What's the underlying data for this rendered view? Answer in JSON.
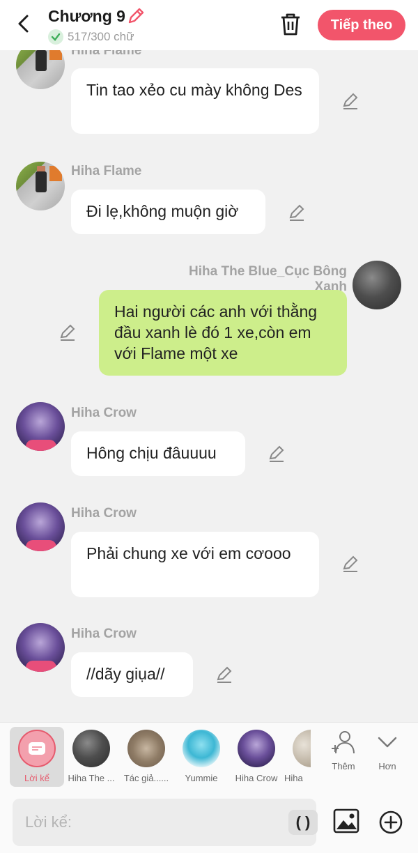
{
  "header": {
    "title": "Chương 9",
    "char_count": "517/300 chữ",
    "next_label": "Tiếp theo",
    "accent": "#f2556b"
  },
  "messages": [
    {
      "sender": "Hiha Flame",
      "text": "Tin tao xẻo cu mày không Des",
      "side": "left",
      "avatar": "flame"
    },
    {
      "sender": "Hiha Flame",
      "text": "Đi lẹ,không muộn giờ",
      "side": "left",
      "avatar": "flame"
    },
    {
      "sender": "Hiha The Blue_Cục Bông Xanh",
      "text": "Hai người các anh với thằng đầu xanh lè đó 1 xe,còn em với Flame một xe",
      "side": "right",
      "avatar": "blue"
    },
    {
      "sender": "Hiha Crow",
      "text": "Hông chịu đâuuuu",
      "side": "left",
      "avatar": "crow"
    },
    {
      "sender": "Hiha Crow",
      "text": "Phải chung xe với em cơooo",
      "side": "left",
      "avatar": "crow"
    },
    {
      "sender": "Hiha Crow",
      "text": "//dãy giụa//",
      "side": "left",
      "avatar": "crow"
    }
  ],
  "characters": [
    {
      "name": "Lời kể",
      "active": true
    },
    {
      "name": "Hiha The ..."
    },
    {
      "name": "Tác giả......"
    },
    {
      "name": "Yummie"
    },
    {
      "name": "Hiha Crow"
    },
    {
      "name": "Hiha"
    }
  ],
  "tools": {
    "more_label": "Thêm",
    "less_label": "Hơn"
  },
  "input": {
    "placeholder": "Lời kể:",
    "paren_label": "( )"
  },
  "colors": {
    "mine_bubble": "#cdee8b",
    "other_bubble": "#ffffff",
    "background": "#f1f1f1"
  }
}
